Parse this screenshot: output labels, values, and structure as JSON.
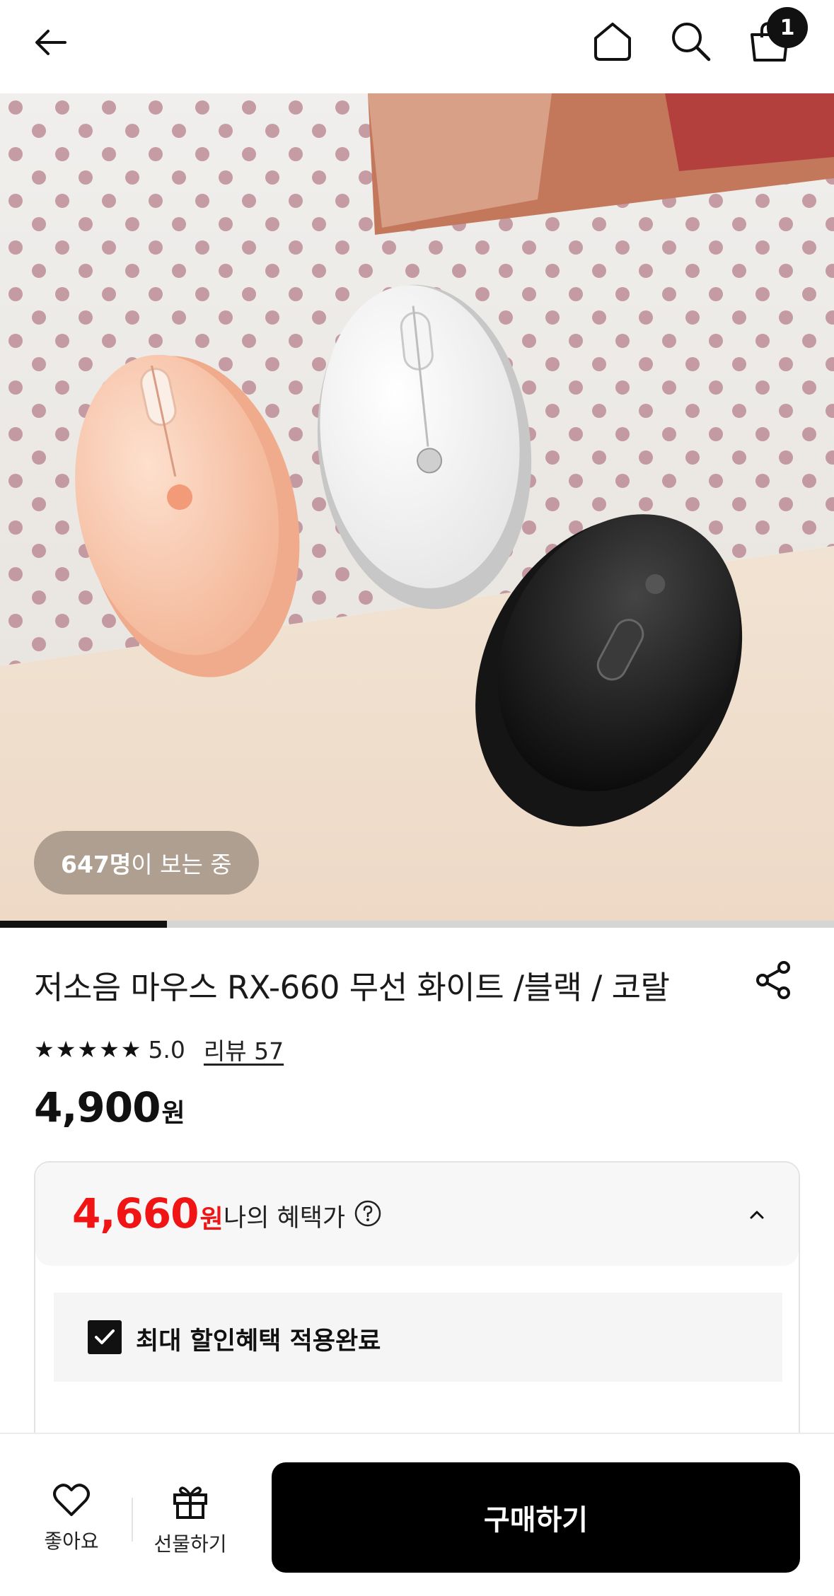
{
  "header": {
    "icons": [
      "back-arrow-icon",
      "home-icon",
      "search-icon",
      "shopping-bag-icon"
    ],
    "cart_count": "1"
  },
  "hero": {
    "viewer_count": "647명",
    "viewer_suffix": "이 보는 중",
    "slide_progress": 0.2
  },
  "product": {
    "title": "저소음 마우스 RX-660 무선 화이트 /블랙 / 코랄",
    "rating_stars": 5,
    "rating": "5.0",
    "review_link": "리뷰 57",
    "price_number": "4,900",
    "price_unit": "원"
  },
  "benefit": {
    "price_number": "4,660",
    "price_unit": "원",
    "label": "나의 혜택가",
    "applied_text": "최대 할인혜택 적용완료",
    "colors": {
      "benefit_price": "#f01414"
    }
  },
  "bottom_bar": {
    "like_label": "좋아요",
    "gift_label": "선물하기",
    "buy_label": "구매하기"
  }
}
